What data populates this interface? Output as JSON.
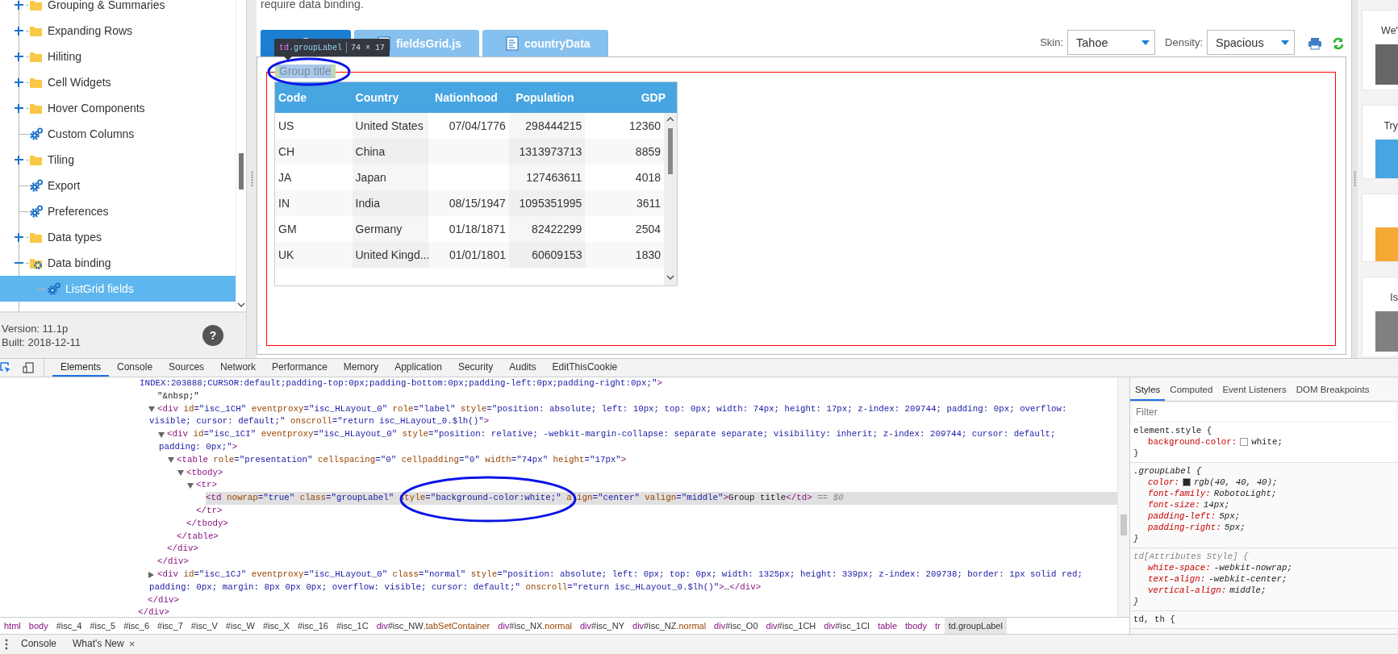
{
  "sidebar": {
    "tree": [
      {
        "kind": "folder",
        "label": "Grouping & Summaries",
        "expanded": false,
        "selected": false
      },
      {
        "kind": "folder",
        "label": "Expanding Rows",
        "expanded": false,
        "selected": false
      },
      {
        "kind": "folder",
        "label": "Hiliting",
        "expanded": false,
        "selected": false
      },
      {
        "kind": "folder",
        "label": "Cell Widgets",
        "expanded": false,
        "selected": false
      },
      {
        "kind": "folder",
        "label": "Hover Components",
        "expanded": false,
        "selected": false
      },
      {
        "kind": "sample",
        "label": "Custom Columns",
        "selected": false
      },
      {
        "kind": "folder",
        "label": "Tiling",
        "expanded": false,
        "selected": false
      },
      {
        "kind": "sample",
        "label": "Export",
        "selected": false
      },
      {
        "kind": "sample",
        "label": "Preferences",
        "selected": false
      },
      {
        "kind": "folder",
        "label": "Data types",
        "expanded": false,
        "selected": false
      },
      {
        "kind": "folder",
        "label": "Data binding",
        "expanded": true,
        "selected": false,
        "children": [
          {
            "kind": "sample",
            "label": "ListGrid fields",
            "selected": true
          }
        ]
      }
    ],
    "version": "Version: 11.1p",
    "built": "Built: 2018-12-11",
    "help": "?"
  },
  "main": {
    "intro": "require data binding.",
    "tabs": [
      {
        "selected": true
      },
      {
        "label": "fieldsGrid.js",
        "selected": false
      },
      {
        "label": "countryData",
        "selected": false
      }
    ],
    "skin": {
      "label": "Skin:",
      "value": "Tahoe"
    },
    "density": {
      "label": "Density:",
      "value": "Spacious"
    },
    "group_title": "Group title",
    "inspector_tooltip": {
      "tag": "td",
      "class": ".groupLabel",
      "size": "74 × 17"
    },
    "grid": {
      "columns": [
        "Code",
        "Country",
        "Nationhood",
        "Population",
        "GDP"
      ],
      "rows": [
        [
          "US",
          "United States",
          "07/04/1776",
          "298444215",
          "12360"
        ],
        [
          "CH",
          "China",
          null,
          "1313973713",
          "8859"
        ],
        [
          "JA",
          "Japan",
          null,
          "127463611",
          "4018"
        ],
        [
          "IN",
          "India",
          "08/15/1947",
          "1095351995",
          "3611"
        ],
        [
          "GM",
          "Germany",
          "01/18/1871",
          "82422299",
          "2504"
        ],
        [
          "UK",
          "United Kingd...",
          "01/01/1801",
          "60609153",
          "1830"
        ]
      ]
    }
  },
  "right_panel": {
    "cards": [
      {
        "text": "We'",
        "color": "#666666"
      },
      {
        "text": "Try",
        "color": "#47a5e1"
      },
      {
        "color": "#f5a833"
      },
      {
        "text": "Is",
        "color": "#808080"
      }
    ]
  },
  "devtools": {
    "tabs": [
      {
        "label": "Elements",
        "selected": true
      },
      {
        "label": "Console",
        "selected": false
      },
      {
        "label": "Sources",
        "selected": false
      },
      {
        "label": "Network",
        "selected": false
      },
      {
        "label": "Performance",
        "selected": false
      },
      {
        "label": "Memory",
        "selected": false
      },
      {
        "label": "Application",
        "selected": false
      },
      {
        "label": "Security",
        "selected": false
      },
      {
        "label": "Audits",
        "selected": false
      },
      {
        "label": "EditThisCookie",
        "selected": false
      }
    ],
    "dom_tree": [
      {
        "selected": false,
        "close": "</div>",
        "children": [
          {
            "selected": false,
            "continued": true,
            "lines": [
              [
                {
                  "kind": "value",
                  "text": "INDEX:203888;CURSOR:default;padding-top:0px;padding-bottom:0px;padding-left:0px;padding-right:0px;\""
                },
                {
                  "kind": "tag",
                  "text": ">"
                }
              ]
            ],
            "close": "</div>",
            "children": [
              {
                "selected": false,
                "lines": [
                  [
                    {
                      "kind": "text",
                      "text": "\"&nbsp;\""
                    }
                  ]
                ]
              },
              {
                "selected": false,
                "expanded": true,
                "lines": [
                  [
                    {
                      "kind": "tag",
                      "text": "<div"
                    },
                    {
                      "kind": "attr",
                      "text": " id"
                    },
                    {
                      "kind": "value",
                      "text": "=\"isc_1CH\""
                    },
                    {
                      "kind": "attr",
                      "text": " eventproxy"
                    },
                    {
                      "kind": "value",
                      "text": "=\"isc_HLayout_0\""
                    },
                    {
                      "kind": "attr",
                      "text": " role"
                    },
                    {
                      "kind": "value",
                      "text": "=\"label\""
                    },
                    {
                      "kind": "attr",
                      "text": " style"
                    },
                    {
                      "kind": "value",
                      "text": "=\"position: absolute; left: 10px; top: 0px; width: 74px; height: 17px; z-index: 209744; padding: 0px; overflow:"
                    }
                  ],
                  [
                    {
                      "kind": "value",
                      "text": "visible; cursor: default;\""
                    },
                    {
                      "kind": "attr",
                      "text": " onscroll"
                    },
                    {
                      "kind": "value",
                      "text": "=\"return isc_HLayout_0.$lh()\""
                    },
                    {
                      "kind": "tag",
                      "text": ">"
                    }
                  ]
                ],
                "close": "</div>",
                "children": [
                  {
                    "selected": false,
                    "expanded": true,
                    "lines": [
                      [
                        {
                          "kind": "tag",
                          "text": "<div"
                        },
                        {
                          "kind": "attr",
                          "text": " id"
                        },
                        {
                          "kind": "value",
                          "text": "=\"isc_1CI\""
                        },
                        {
                          "kind": "attr",
                          "text": " eventproxy"
                        },
                        {
                          "kind": "value",
                          "text": "=\"isc_HLayout_0\""
                        },
                        {
                          "kind": "attr",
                          "text": " style"
                        },
                        {
                          "kind": "value",
                          "text": "=\"position: relative; -webkit-margin-collapse: separate separate; visibility: inherit; z-index: 209744; cursor: default;"
                        }
                      ],
                      [
                        {
                          "kind": "value",
                          "text": "padding: 0px;\""
                        },
                        {
                          "kind": "tag",
                          "text": ">"
                        }
                      ]
                    ],
                    "close": "</div>",
                    "children": [
                      {
                        "selected": false,
                        "expanded": true,
                        "lines": [
                          [
                            {
                              "kind": "tag",
                              "text": "<table"
                            },
                            {
                              "kind": "attr",
                              "text": " role"
                            },
                            {
                              "kind": "value",
                              "text": "=\"presentation\""
                            },
                            {
                              "kind": "attr",
                              "text": " cellspacing"
                            },
                            {
                              "kind": "value",
                              "text": "=\"0\""
                            },
                            {
                              "kind": "attr",
                              "text": " cellpadding"
                            },
                            {
                              "kind": "value",
                              "text": "=\"0\""
                            },
                            {
                              "kind": "attr",
                              "text": " width"
                            },
                            {
                              "kind": "value",
                              "text": "=\"74px\""
                            },
                            {
                              "kind": "attr",
                              "text": " height"
                            },
                            {
                              "kind": "value",
                              "text": "=\"17px\""
                            },
                            {
                              "kind": "tag",
                              "text": ">"
                            }
                          ]
                        ],
                        "close": "</table>",
                        "children": [
                          {
                            "selected": false,
                            "expanded": true,
                            "lines": [
                              [
                                {
                                  "kind": "tag",
                                  "text": "<tbody>"
                                }
                              ]
                            ],
                            "close": "</tbody>",
                            "children": [
                              {
                                "selected": false,
                                "expanded": true,
                                "lines": [
                                  [
                                    {
                                      "kind": "tag",
                                      "text": "<tr>"
                                    }
                                  ]
                                ],
                                "close": "</tr>",
                                "children": [
                                  {
                                    "selected": true,
                                    "lines": [
                                      [
                                        {
                                          "kind": "tag",
                                          "text": "<td"
                                        },
                                        {
                                          "kind": "attr",
                                          "text": " nowrap"
                                        },
                                        {
                                          "kind": "value",
                                          "text": "=\"true\""
                                        },
                                        {
                                          "kind": "attr",
                                          "text": " class"
                                        },
                                        {
                                          "kind": "value",
                                          "text": "=\"groupLabel\""
                                        },
                                        {
                                          "kind": "attr",
                                          "text": " style"
                                        },
                                        {
                                          "kind": "value",
                                          "text": "=\"background-color:white;\""
                                        },
                                        {
                                          "kind": "attr",
                                          "text": " align"
                                        },
                                        {
                                          "kind": "value",
                                          "text": "=\"center\""
                                        },
                                        {
                                          "kind": "attr",
                                          "text": " valign"
                                        },
                                        {
                                          "kind": "value",
                                          "text": "=\"middle\""
                                        },
                                        {
                                          "kind": "tag",
                                          "text": ">"
                                        },
                                        {
                                          "kind": "text",
                                          "text": "Group title"
                                        },
                                        {
                                          "kind": "tag",
                                          "text": "</td>"
                                        },
                                        {
                                          "kind": "hint",
                                          "text": " == $0"
                                        }
                                      ]
                                    ]
                                  }
                                ]
                              }
                            ]
                          }
                        ]
                      }
                    ]
                  }
                ]
              },
              {
                "selected": false,
                "expanded": false,
                "lines": [
                  [
                    {
                      "kind": "tag",
                      "text": "<div"
                    },
                    {
                      "kind": "attr",
                      "text": " id"
                    },
                    {
                      "kind": "value",
                      "text": "=\"isc_1CJ\""
                    },
                    {
                      "kind": "attr",
                      "text": " eventproxy"
                    },
                    {
                      "kind": "value",
                      "text": "=\"isc_HLayout_0\""
                    },
                    {
                      "kind": "attr",
                      "text": " class"
                    },
                    {
                      "kind": "value",
                      "text": "=\"normal\""
                    },
                    {
                      "kind": "attr",
                      "text": " style"
                    },
                    {
                      "kind": "value",
                      "text": "=\"position: absolute; left: 0px; top: 0px; width: 1325px; height: 339px; z-index: 209738; border: 1px solid red;"
                    }
                  ],
                  [
                    {
                      "kind": "value",
                      "text": "padding: 0px; margin: 8px 0px 0px; overflow: visible; cursor: default;\""
                    },
                    {
                      "kind": "attr",
                      "text": " onscroll"
                    },
                    {
                      "kind": "value",
                      "text": "=\"return isc_HLayout_0.$lh()\""
                    },
                    {
                      "kind": "tag",
                      "text": ">"
                    },
                    {
                      "kind": "text",
                      "text": "…"
                    },
                    {
                      "kind": "tag",
                      "text": "</div>"
                    }
                  ]
                ]
              }
            ]
          }
        ]
      }
    ],
    "breadcrumbs": [
      {
        "selected": false,
        "parts": [
          {
            "kind": "tag",
            "text": "html"
          }
        ]
      },
      {
        "selected": false,
        "parts": [
          {
            "kind": "tag",
            "text": "body"
          }
        ]
      },
      {
        "selected": false,
        "parts": [
          {
            "kind": "id",
            "text": "#isc_4"
          }
        ]
      },
      {
        "selected": false,
        "parts": [
          {
            "kind": "id",
            "text": "#isc_5"
          }
        ]
      },
      {
        "selected": false,
        "parts": [
          {
            "kind": "id",
            "text": "#isc_6"
          }
        ]
      },
      {
        "selected": false,
        "parts": [
          {
            "kind": "id",
            "text": "#isc_7"
          }
        ]
      },
      {
        "selected": false,
        "parts": [
          {
            "kind": "id",
            "text": "#isc_V"
          }
        ]
      },
      {
        "selected": false,
        "parts": [
          {
            "kind": "id",
            "text": "#isc_W"
          }
        ]
      },
      {
        "selected": false,
        "parts": [
          {
            "kind": "id",
            "text": "#isc_X"
          }
        ]
      },
      {
        "selected": false,
        "parts": [
          {
            "kind": "id",
            "text": "#isc_16"
          }
        ]
      },
      {
        "selected": false,
        "parts": [
          {
            "kind": "id",
            "text": "#isc_1C"
          }
        ]
      },
      {
        "selected": false,
        "parts": [
          {
            "kind": "tag",
            "text": "div"
          },
          {
            "kind": "id",
            "text": "#isc_NW"
          },
          {
            "kind": "class",
            "text": ".tabSetContainer"
          }
        ]
      },
      {
        "selected": false,
        "parts": [
          {
            "kind": "tag",
            "text": "div"
          },
          {
            "kind": "id",
            "text": "#isc_NX"
          },
          {
            "kind": "class",
            "text": ".normal"
          }
        ]
      },
      {
        "selected": false,
        "parts": [
          {
            "kind": "tag",
            "text": "div"
          },
          {
            "kind": "id",
            "text": "#isc_NY"
          }
        ]
      },
      {
        "selected": false,
        "parts": [
          {
            "kind": "tag",
            "text": "div"
          },
          {
            "kind": "id",
            "text": "#isc_NZ"
          },
          {
            "kind": "class",
            "text": ".normal"
          }
        ]
      },
      {
        "selected": false,
        "parts": [
          {
            "kind": "tag",
            "text": "div"
          },
          {
            "kind": "id",
            "text": "#isc_O0"
          }
        ]
      },
      {
        "selected": false,
        "parts": [
          {
            "kind": "tag",
            "text": "div"
          },
          {
            "kind": "id",
            "text": "#isc_1CH"
          }
        ]
      },
      {
        "selected": false,
        "parts": [
          {
            "kind": "tag",
            "text": "div"
          },
          {
            "kind": "id",
            "text": "#isc_1CI"
          }
        ]
      },
      {
        "selected": false,
        "parts": [
          {
            "kind": "tag",
            "text": "table"
          }
        ]
      },
      {
        "selected": false,
        "parts": [
          {
            "kind": "tag",
            "text": "tbody"
          }
        ]
      },
      {
        "selected": false,
        "parts": [
          {
            "kind": "tag",
            "text": "tr"
          }
        ]
      },
      {
        "selected": true,
        "parts": [
          {
            "kind": "id",
            "text": "td.groupLabel"
          }
        ]
      }
    ],
    "styles": {
      "tabs": [
        {
          "label": "Styles",
          "selected": true
        },
        {
          "label": "Computed",
          "selected": false
        },
        {
          "label": "Event Listeners",
          "selected": false
        },
        {
          "label": "DOM Breakpoints",
          "selected": false
        }
      ],
      "filter_placeholder": "Filter",
      "rules": [
        {
          "selector": "element.style {",
          "italic": false,
          "muted": false,
          "declarations": [
            {
              "property": "background-color:",
              "color": "#ffffff",
              "value": "white;"
            }
          ],
          "close": "}"
        },
        {
          "selector": ".groupLabel {",
          "italic": true,
          "muted": false,
          "declarations": [
            {
              "property": "color:",
              "color": "#282828",
              "value": "rgb(40, 40, 40);"
            },
            {
              "property": "font-family:",
              "value": "RobotoLight;"
            },
            {
              "property": "font-size:",
              "value": "14px;"
            },
            {
              "property": "padding-left:",
              "value": "5px;"
            },
            {
              "property": "padding-right:",
              "value": "5px;"
            }
          ],
          "close": "}"
        },
        {
          "selector": "td[Attributes Style] {",
          "italic": true,
          "muted": true,
          "declarations": [
            {
              "property": "white-space:",
              "value": "-webkit-nowrap;"
            },
            {
              "property": "text-align:",
              "value": "-webkit-center;"
            },
            {
              "property": "vertical-align:",
              "value": "middle;"
            }
          ],
          "close": "}"
        },
        {
          "selector": "td, th {",
          "italic": false,
          "muted": false
        }
      ]
    },
    "drawer": {
      "tabs": [
        {
          "label": "Console",
          "selected": false
        },
        {
          "label": "What's New",
          "selected": false,
          "close": "×"
        }
      ]
    }
  }
}
